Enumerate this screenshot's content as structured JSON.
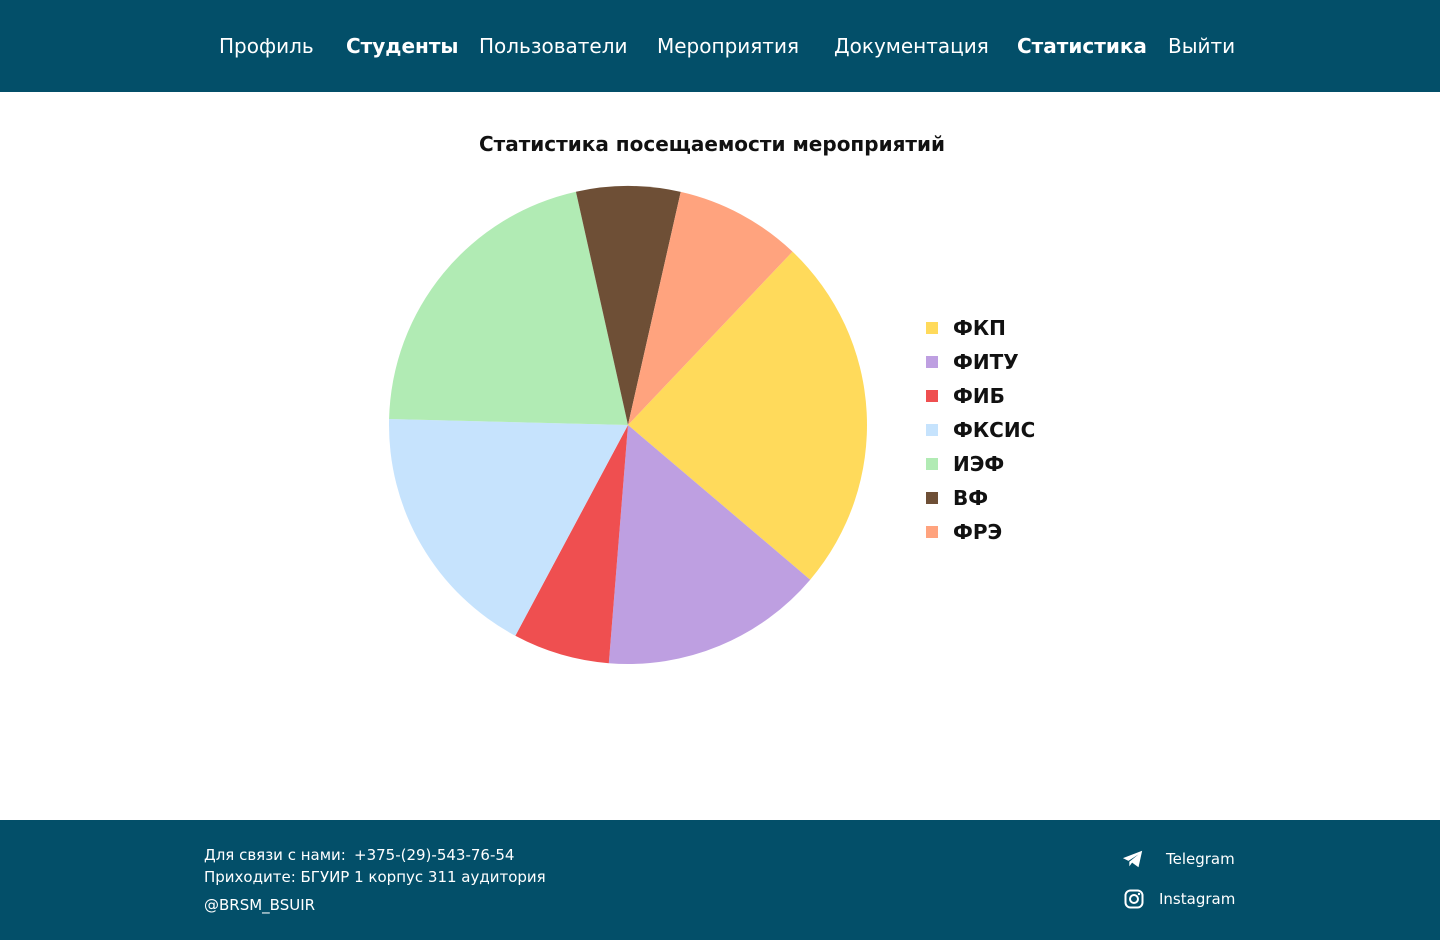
{
  "nav": {
    "items": [
      {
        "label": "Профиль",
        "bold": false
      },
      {
        "label": "Студенты",
        "bold": true
      },
      {
        "label": "Пользователи",
        "bold": false
      },
      {
        "label": "Мероприятия",
        "bold": false
      },
      {
        "label": "Документация",
        "bold": false
      },
      {
        "label": "Статистика",
        "bold": true
      },
      {
        "label": "Выйти",
        "bold": false
      }
    ]
  },
  "chart_data": {
    "type": "pie",
    "title": "Статистика посещаемости мероприятий",
    "categories": [
      "ФКП",
      "ФИТУ",
      "ФИБ",
      "ФКСИС",
      "ИЭФ",
      "ВФ",
      "ФРЭ"
    ],
    "values": [
      24,
      15,
      6.5,
      17.5,
      21,
      7,
      8.5
    ],
    "colors": [
      "#ffda5b",
      "#be9fe1",
      "#ef4f50",
      "#c6e3fd",
      "#b1ebb4",
      "#6e4f36",
      "#ffa37e"
    ],
    "legend_placement": "right"
  },
  "footer": {
    "contact_label": "Для связи с нами:",
    "phone": "+375-(29)-543-76-54",
    "address": "Приходите: БГУИР 1 корпус 311 аудитория",
    "handle": "@BRSM_BSUIR",
    "telegram_label": "Telegram",
    "instagram_label": "Instagram",
    "telegram_icon": "telegram-icon",
    "instagram_icon": "instagram-icon"
  },
  "colors": {
    "header_bg": "#034f69",
    "footer_bg": "#034f69"
  }
}
